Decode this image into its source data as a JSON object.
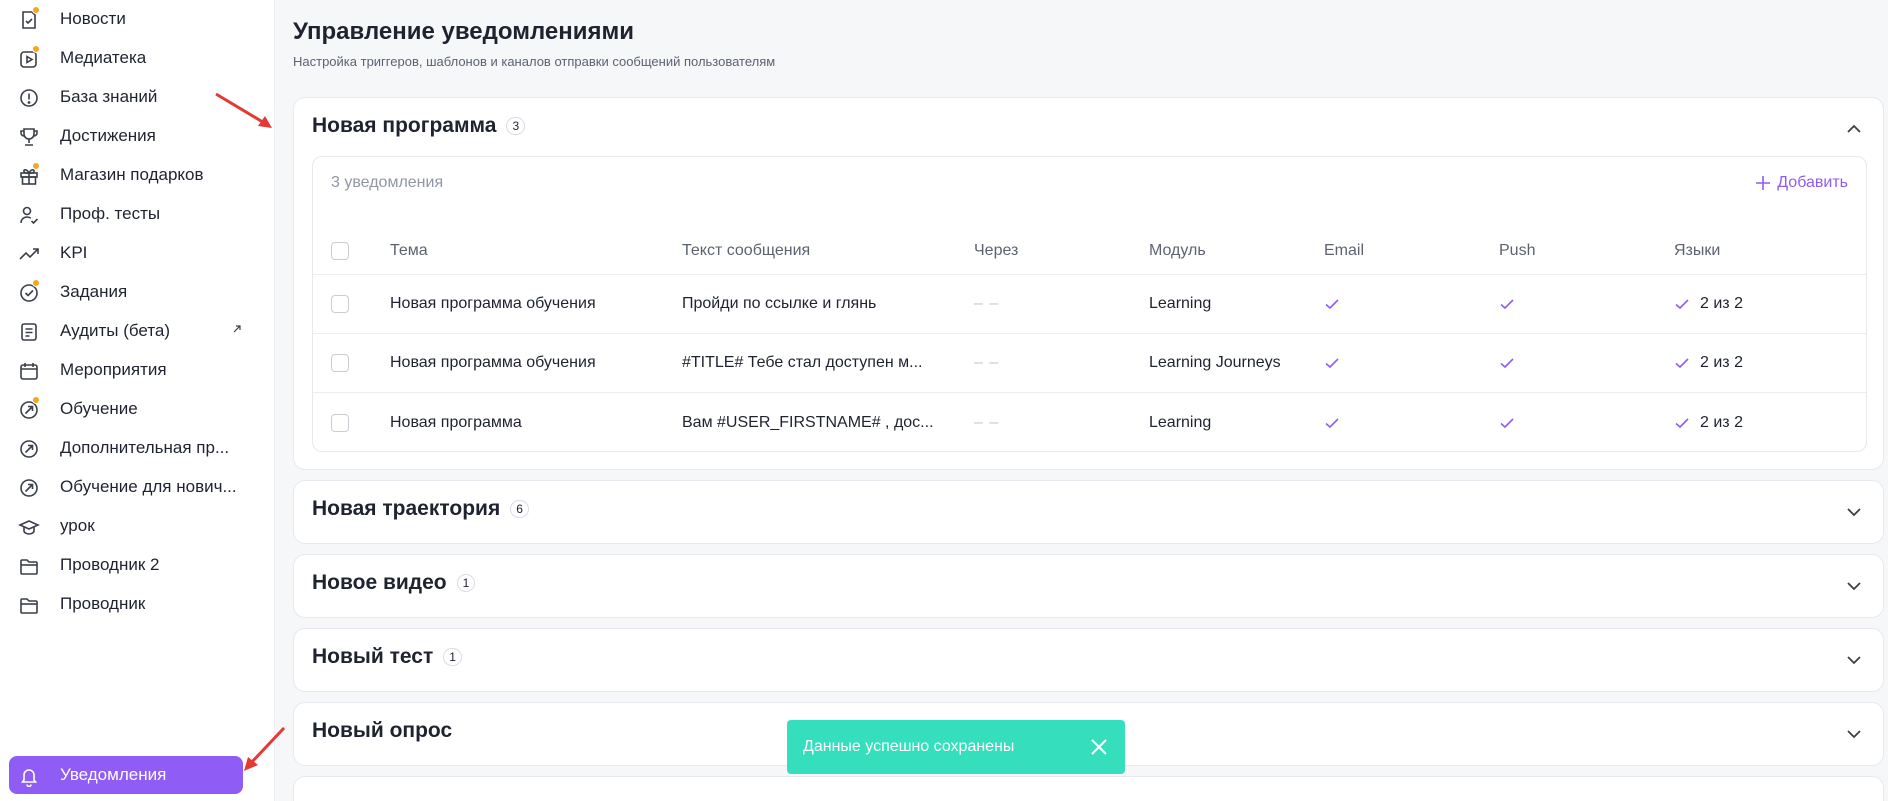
{
  "sidebar": {
    "items": [
      {
        "label": "Новости",
        "icon": "news-icon",
        "badge": true
      },
      {
        "label": "Медиатека",
        "icon": "media-play-icon",
        "badge": true
      },
      {
        "label": "База знаний",
        "icon": "info-circle-icon",
        "badge": false
      },
      {
        "label": "Достижения",
        "icon": "trophy-icon",
        "badge": false
      },
      {
        "label": "Магазин подарков",
        "icon": "gift-icon",
        "badge": true
      },
      {
        "label": "Проф. тесты",
        "icon": "user-check-icon",
        "badge": false
      },
      {
        "label": "KPI",
        "icon": "trend-up-icon",
        "badge": false
      },
      {
        "label": "Задания",
        "icon": "task-check-icon",
        "badge": true
      },
      {
        "label": "Аудиты (бета)",
        "icon": "document-icon",
        "badge": false,
        "external": true
      },
      {
        "label": "Мероприятия",
        "icon": "calendar-icon",
        "badge": false
      },
      {
        "label": "Обучение",
        "icon": "learning-arrow-icon",
        "badge": true
      },
      {
        "label": "Дополнительная пр...",
        "icon": "learning-arrow-icon",
        "badge": false
      },
      {
        "label": "Обучение для нович...",
        "icon": "learning-arrow-icon",
        "badge": false
      },
      {
        "label": "урок",
        "icon": "graduation-cap-icon",
        "badge": false
      },
      {
        "label": "Проводник 2",
        "icon": "folder-icon",
        "badge": false
      },
      {
        "label": "Проводник",
        "icon": "folder-icon",
        "badge": false
      },
      {
        "label": "Уведомления",
        "icon": "bell-icon",
        "badge": false,
        "active": true
      }
    ]
  },
  "page": {
    "title": "Управление уведомлениями",
    "subtitle": "Настройка триггеров, шаблонов и каналов отправки сообщений пользователям"
  },
  "sections": [
    {
      "title": "Новая программа",
      "count": "3",
      "expanded": true,
      "caption": "3 уведомления",
      "add_label": "Добавить",
      "columns": [
        "Тема",
        "Текст сообщения",
        "Через",
        "Модуль",
        "Email",
        "Push",
        "Языки"
      ],
      "rows": [
        {
          "topic": "Новая программа обучения",
          "text": "Пройди по ссылке и глянь",
          "after": "– –",
          "module": "Learning",
          "email": true,
          "push": true,
          "langs": "2 из 2"
        },
        {
          "topic": "Новая программа обучения",
          "text": "#TITLE# Тебе стал доступен м...",
          "after": "– –",
          "module": "Learning Journeys",
          "email": true,
          "push": true,
          "langs": "2 из 2"
        },
        {
          "topic": "Новая программа",
          "text": "Вам #USER_FIRSTNAME# , дос...",
          "after": "– –",
          "module": "Learning",
          "email": true,
          "push": true,
          "langs": "2 из 2"
        }
      ]
    },
    {
      "title": "Новая траектория",
      "count": "6",
      "expanded": false
    },
    {
      "title": "Новое видео",
      "count": "1",
      "expanded": false
    },
    {
      "title": "Новый тест",
      "count": "1",
      "expanded": false
    },
    {
      "title": "Новый опрос",
      "count": "",
      "expanded": false
    }
  ],
  "toast": {
    "text": "Данные успешно сохранены"
  },
  "colors": {
    "accent": "#8f5cf6",
    "toast": "#35dfbd",
    "badge_dot": "#f5a524",
    "annotation": "#e53935"
  }
}
